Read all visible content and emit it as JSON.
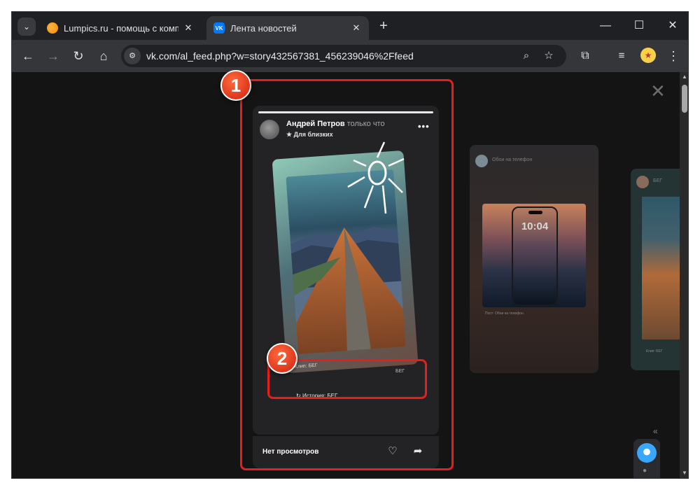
{
  "browser": {
    "tabs": [
      {
        "title": "Lumpics.ru - помощь с компьютером",
        "favicon": "orange-circle-icon",
        "active": false
      },
      {
        "title": "Лента новостей",
        "favicon": "vk-icon",
        "active": true
      }
    ],
    "url": "vk.com/al_feed.php?w=story432567381_456239046%2Ffeed"
  },
  "story": {
    "author": "Андрей Петров",
    "time": "только что",
    "audience": "Для близких",
    "sticker_caption": "Клип: БЕГ",
    "sticker_caption_right": "БЕГ",
    "history_link": "История: БЕГ",
    "views": "Нет просмотров",
    "progress_fraction": 1.0
  },
  "side_previews": [
    {
      "title": "Обои на телефон",
      "clock": "10:04",
      "caption": "Пост: Обои на телефон"
    },
    {
      "title": "БЕГ",
      "caption": "Клип: БЕГ"
    }
  ],
  "annotations": [
    {
      "number": "1"
    },
    {
      "number": "2"
    }
  ],
  "colors": {
    "highlight": "#e51e1e",
    "vk_blue": "#0077ff",
    "background": "#141414"
  }
}
